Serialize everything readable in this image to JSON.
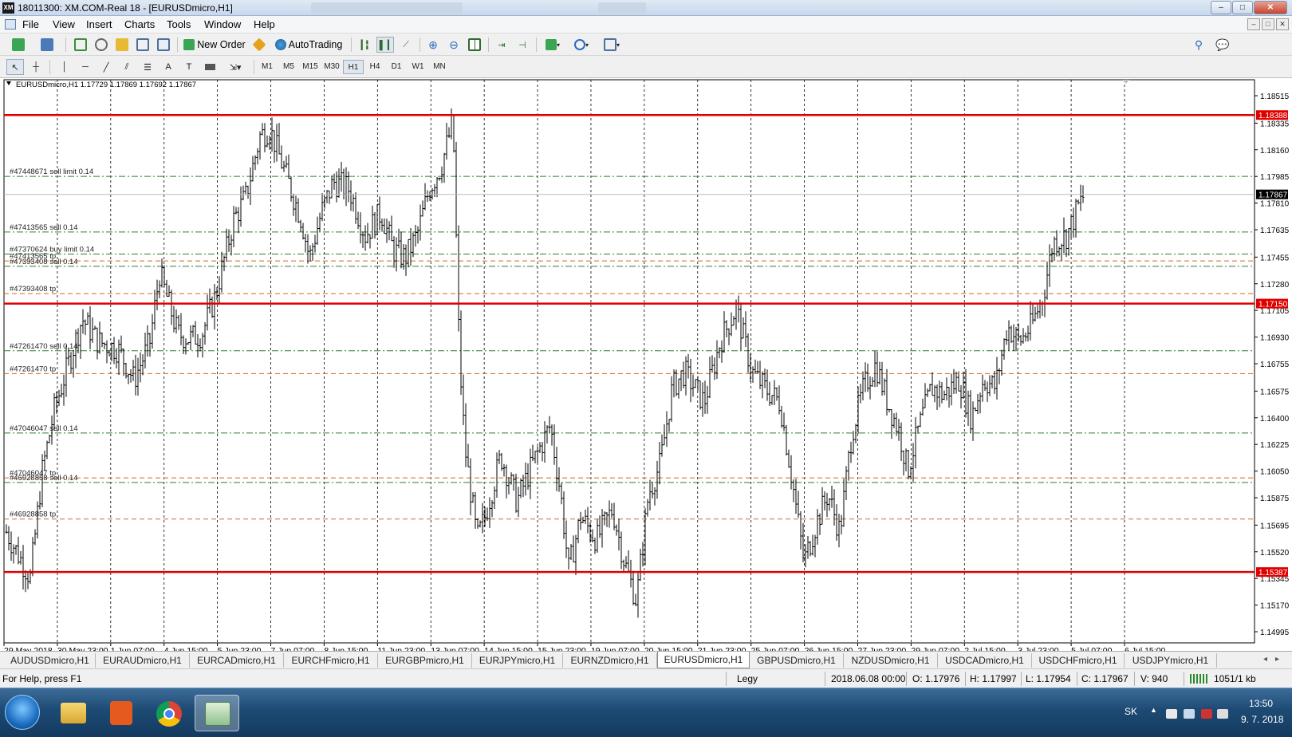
{
  "window": {
    "title": "18011300: XM.COM-Real 18 - [EURUSDmicro,H1]",
    "app_badge": "XM",
    "minimize": "–",
    "maximize": "□",
    "close": "✕"
  },
  "menu": [
    "File",
    "View",
    "Insert",
    "Charts",
    "Tools",
    "Window",
    "Help"
  ],
  "toolbar": {
    "new_order": "New Order",
    "autotrading": "AutoTrading"
  },
  "timeframes": [
    "M1",
    "M5",
    "M15",
    "M30",
    "H1",
    "H4",
    "D1",
    "W1",
    "MN"
  ],
  "active_timeframe": "H1",
  "chart_data": {
    "type": "ohlc",
    "info": "EURUSDmicro,H1  1.17729 1.17869 1.17692 1.17867",
    "y_axis": {
      "min": 1.14995,
      "max": 1.18515,
      "ticks": [
        "1.18515",
        "1.18335",
        "1.18160",
        "1.17985",
        "1.17810",
        "1.17635",
        "1.17455",
        "1.17280",
        "1.17105",
        "1.16930",
        "1.16755",
        "1.16575",
        "1.16400",
        "1.16225",
        "1.16050",
        "1.15875",
        "1.15695",
        "1.15520",
        "1.15345",
        "1.15170",
        "1.14995"
      ]
    },
    "x_labels": [
      "29 May 2018",
      "30 May 23:00",
      "1 Jun 07:00",
      "4 Jun 15:00",
      "5 Jun 23:00",
      "7 Jun 07:00",
      "8 Jun 15:00",
      "11 Jun 23:00",
      "13 Jun 07:00",
      "14 Jun 15:00",
      "15 Jun 23:00",
      "19 Jun 07:00",
      "20 Jun 15:00",
      "21 Jun 23:00",
      "25 Jun 07:00",
      "26 Jun 15:00",
      "27 Jun 23:00",
      "29 Jun 07:00",
      "2 Jul 15:00",
      "3 Jul 23:00",
      "5 Jul 07:00",
      "6 Jul 15:00"
    ],
    "levels": [
      {
        "price": 1.18388,
        "label": "1.18388",
        "color": "#e00000"
      },
      {
        "price": 1.1715,
        "label": "1.17150",
        "color": "#e00000"
      },
      {
        "price": 1.15387,
        "label": "1.15387",
        "color": "#e00000"
      }
    ],
    "current_price": {
      "price": 1.17867,
      "label": "1.17867"
    },
    "orders": [
      {
        "price": 1.17985,
        "label": "#47448671 sell limit 0.14",
        "color": "#2e7d32"
      },
      {
        "price": 1.1762,
        "label": "#47413565 sell 0.14",
        "color": "#2e7d32"
      },
      {
        "price": 1.17475,
        "label": "#47370624 buy limit 0.14",
        "color": "#2e7d32"
      },
      {
        "price": 1.1743,
        "label": "#47413565 tp",
        "color": "#d2691e"
      },
      {
        "price": 1.17395,
        "label": "#47393408 sell 0.14",
        "color": "#2e7d32"
      },
      {
        "price": 1.17215,
        "label": "#47393408 tp",
        "color": "#d2691e"
      },
      {
        "price": 1.1684,
        "label": "#47261470 sell 0.14",
        "color": "#2e7d32"
      },
      {
        "price": 1.1669,
        "label": "#47261470 tp",
        "color": "#d2691e"
      },
      {
        "price": 1.163,
        "label": "#47046047 sell 0.14",
        "color": "#2e7d32"
      },
      {
        "price": 1.16005,
        "label": "#47046047 tp",
        "color": "#d2691e"
      },
      {
        "price": 1.15975,
        "label": "#46928858 sell 0.14",
        "color": "#2e7d32"
      },
      {
        "price": 1.15735,
        "label": "#46928858 tp",
        "color": "#d2691e"
      }
    ],
    "path": [
      [
        0,
        1.1565
      ],
      [
        30,
        1.1535
      ],
      [
        45,
        1.1605
      ],
      [
        60,
        1.1645
      ],
      [
        95,
        1.1705
      ],
      [
        115,
        1.169
      ],
      [
        140,
        1.1685
      ],
      [
        160,
        1.1665
      ],
      [
        180,
        1.169
      ],
      [
        192,
        1.1735
      ],
      [
        215,
        1.1695
      ],
      [
        230,
        1.1692
      ],
      [
        245,
        1.1695
      ],
      [
        262,
        1.172
      ],
      [
        285,
        1.177
      ],
      [
        300,
        1.1785
      ],
      [
        318,
        1.1825
      ],
      [
        330,
        1.183
      ],
      [
        350,
        1.18
      ],
      [
        370,
        1.177
      ],
      [
        380,
        1.1745
      ],
      [
        395,
        1.1775
      ],
      [
        410,
        1.1795
      ],
      [
        430,
        1.179
      ],
      [
        450,
        1.176
      ],
      [
        470,
        1.1775
      ],
      [
        485,
        1.175
      ],
      [
        500,
        1.1745
      ],
      [
        515,
        1.176
      ],
      [
        530,
        1.179
      ],
      [
        545,
        1.1805
      ],
      [
        560,
        1.1835
      ],
      [
        568,
        1.168
      ],
      [
        575,
        1.162
      ],
      [
        590,
        1.156
      ],
      [
        600,
        1.1575
      ],
      [
        620,
        1.1615
      ],
      [
        640,
        1.1585
      ],
      [
        660,
        1.161
      ],
      [
        682,
        1.1635
      ],
      [
        695,
        1.159
      ],
      [
        705,
        1.154
      ],
      [
        720,
        1.1575
      ],
      [
        740,
        1.156
      ],
      [
        760,
        1.158
      ],
      [
        775,
        1.1545
      ],
      [
        790,
        1.152
      ],
      [
        805,
        1.159
      ],
      [
        820,
        1.161
      ],
      [
        835,
        1.166
      ],
      [
        850,
        1.167
      ],
      [
        875,
        1.165
      ],
      [
        895,
        1.169
      ],
      [
        915,
        1.1712
      ],
      [
        935,
        1.167
      ],
      [
        950,
        1.166
      ],
      [
        970,
        1.165
      ],
      [
        985,
        1.16
      ],
      [
        1000,
        1.1545
      ],
      [
        1015,
        1.157
      ],
      [
        1030,
        1.159
      ],
      [
        1045,
        1.1565
      ],
      [
        1060,
        1.163
      ],
      [
        1075,
        1.166
      ],
      [
        1090,
        1.1675
      ],
      [
        1105,
        1.165
      ],
      [
        1120,
        1.163
      ],
      [
        1130,
        1.1605
      ],
      [
        1145,
        1.1635
      ],
      [
        1160,
        1.166
      ],
      [
        1175,
        1.1655
      ],
      [
        1195,
        1.1665
      ],
      [
        1210,
        1.164
      ],
      [
        1225,
        1.1665
      ],
      [
        1240,
        1.166
      ],
      [
        1255,
        1.17
      ],
      [
        1270,
        1.169
      ],
      [
        1285,
        1.17
      ],
      [
        1300,
        1.172
      ],
      [
        1312,
        1.1755
      ],
      [
        1330,
        1.176
      ],
      [
        1345,
        1.178
      ],
      [
        1352,
        1.1787
      ]
    ]
  },
  "symbol_tabs": [
    "AUDUSDmicro,H1",
    "EURAUDmicro,H1",
    "EURCADmicro,H1",
    "EURCHFmicro,H1",
    "EURGBPmicro,H1",
    "EURJPYmicro,H1",
    "EURNZDmicro,H1",
    "EURUSDmicro,H1",
    "GBPUSDmicro,H1",
    "NZDUSDmicro,H1",
    "USDCADmicro,H1",
    "USDCHFmicro,H1",
    "USDJPYmicro,H1"
  ],
  "active_tab": "EURUSDmicro,H1",
  "status": {
    "help": "For Help, press F1",
    "profile": "Legy",
    "datetime": "2018.06.08 00:00",
    "open": "O: 1.17976",
    "high": "H: 1.17997",
    "low": "L: 1.17954",
    "close": "C: 1.17967",
    "volume": "V: 940",
    "traffic": "1051/1 kb"
  },
  "taskbar": {
    "lang": "SK",
    "time": "13:50",
    "date": "9. 7. 2018"
  },
  "colors": {
    "level": "#e00000",
    "order_green": "#2e7d32",
    "order_orange": "#d2691e",
    "bars": "#000000"
  }
}
